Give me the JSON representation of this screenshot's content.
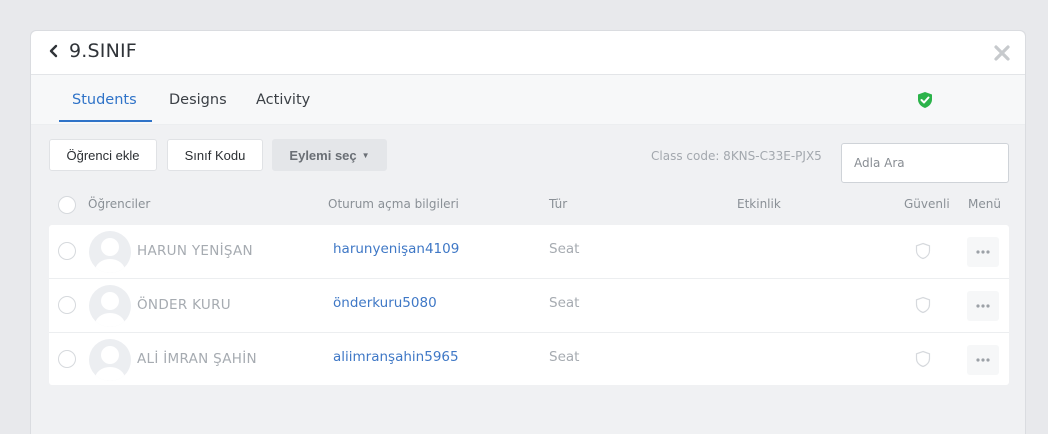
{
  "header": {
    "title": "9.SINIF"
  },
  "tabs": [
    {
      "label": "Students"
    },
    {
      "label": "Designs"
    },
    {
      "label": "Activity"
    }
  ],
  "toolbar": {
    "add_student": "Öğrenci ekle",
    "class_code_btn": "Sınıf Kodu",
    "select_action": "Eylemi seç",
    "class_code_text": "Class code: 8KNS-C33E-PJX5",
    "search_placeholder": "Adla Ara"
  },
  "table": {
    "headers": {
      "students": "Öğrenciler",
      "login": "Oturum açma bilgileri",
      "type": "Tür",
      "activity": "Etkinlik",
      "secure": "Güvenli",
      "menu": "Menü"
    },
    "rows": [
      {
        "name": "HARUN YENİŞAN",
        "login": "harunyenişan4109",
        "type": "Seat"
      },
      {
        "name": "ÖNDER KURU",
        "login": "önderkuru5080",
        "type": "Seat"
      },
      {
        "name": "ALİ İMRAN ŞAHİN",
        "login": "aliimranşahin5965",
        "type": "Seat"
      }
    ]
  },
  "colors": {
    "accent": "#2f73c8",
    "secure_ok": "#2bb34a"
  }
}
